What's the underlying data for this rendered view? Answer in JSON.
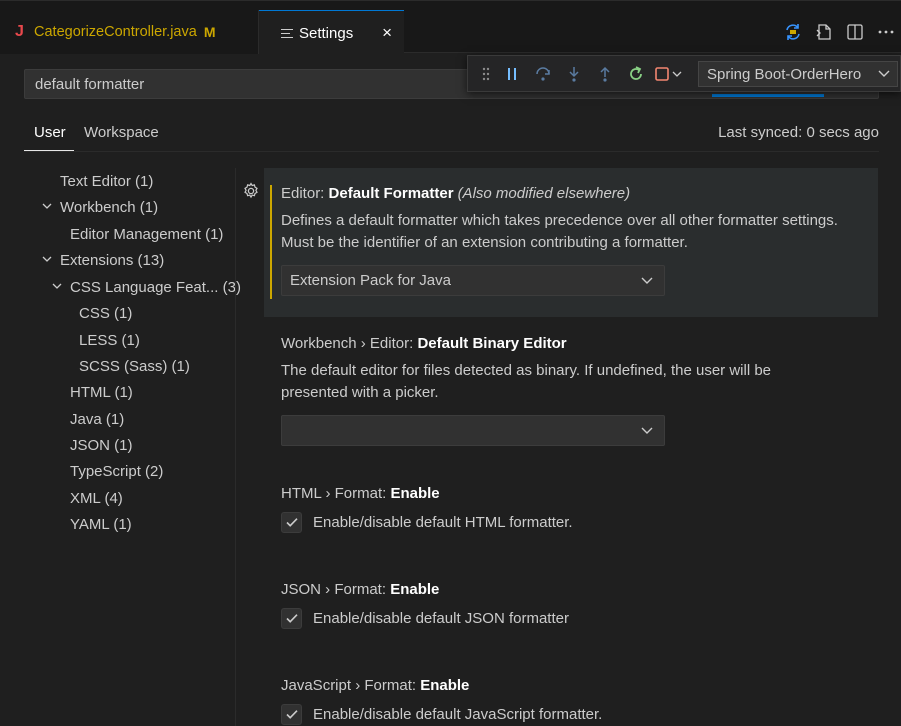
{
  "tabs": [
    {
      "icon": "java-file-icon",
      "glyph": "J",
      "label": "CategorizeController.java",
      "status": "M"
    },
    {
      "icon": "settings-file-icon",
      "label": "Settings",
      "close": "×"
    }
  ],
  "search": {
    "value": "default formatter"
  },
  "debug_toolbar": {
    "configuration": "Spring Boot-OrderHero"
  },
  "scope_tabs": {
    "user": "User",
    "workspace": "Workspace",
    "last_synced": "Last synced: 0 secs ago"
  },
  "toc": [
    {
      "label": "Text Editor (1)"
    },
    {
      "label": "Workbench (1)"
    },
    {
      "label": "Editor Management (1)"
    },
    {
      "label": "Extensions (13)"
    },
    {
      "label": "CSS Language Feat... (3)"
    },
    {
      "label": "CSS (1)"
    },
    {
      "label": "LESS (1)"
    },
    {
      "label": "SCSS (Sass) (1)"
    },
    {
      "label": "HTML (1)"
    },
    {
      "label": "Java (1)"
    },
    {
      "label": "JSON (1)"
    },
    {
      "label": "TypeScript (2)"
    },
    {
      "label": "XML (4)"
    },
    {
      "label": "YAML (1)"
    }
  ],
  "settings": [
    {
      "category": "Editor: ",
      "name": "Default Formatter",
      "note": "(Also modified elsewhere)",
      "description_line1": "Defines a default formatter which takes precedence over all other formatter settings.",
      "description_line2": "Must be the identifier of an extension contributing a formatter.",
      "value": "Extension Pack for Java"
    },
    {
      "category": "Workbench › Editor: ",
      "name": "Default Binary Editor",
      "description_line1": "The default editor for files detected as binary. If undefined, the user will be",
      "description_line2": "presented with a picker.",
      "value": ""
    },
    {
      "category": "HTML › Format: ",
      "name": "Enable",
      "checkbox_label": "Enable/disable default HTML formatter.",
      "checked": true
    },
    {
      "category": "JSON › Format: ",
      "name": "Enable",
      "checkbox_label": "Enable/disable default JSON formatter",
      "checked": true
    },
    {
      "category": "JavaScript › Format: ",
      "name": "Enable",
      "checkbox_label": "Enable/disable default JavaScript formatter.",
      "checked": true
    }
  ],
  "colors": {
    "accent": "#0078d4",
    "modified": "#cca700",
    "java_icon": "#e8484c"
  }
}
